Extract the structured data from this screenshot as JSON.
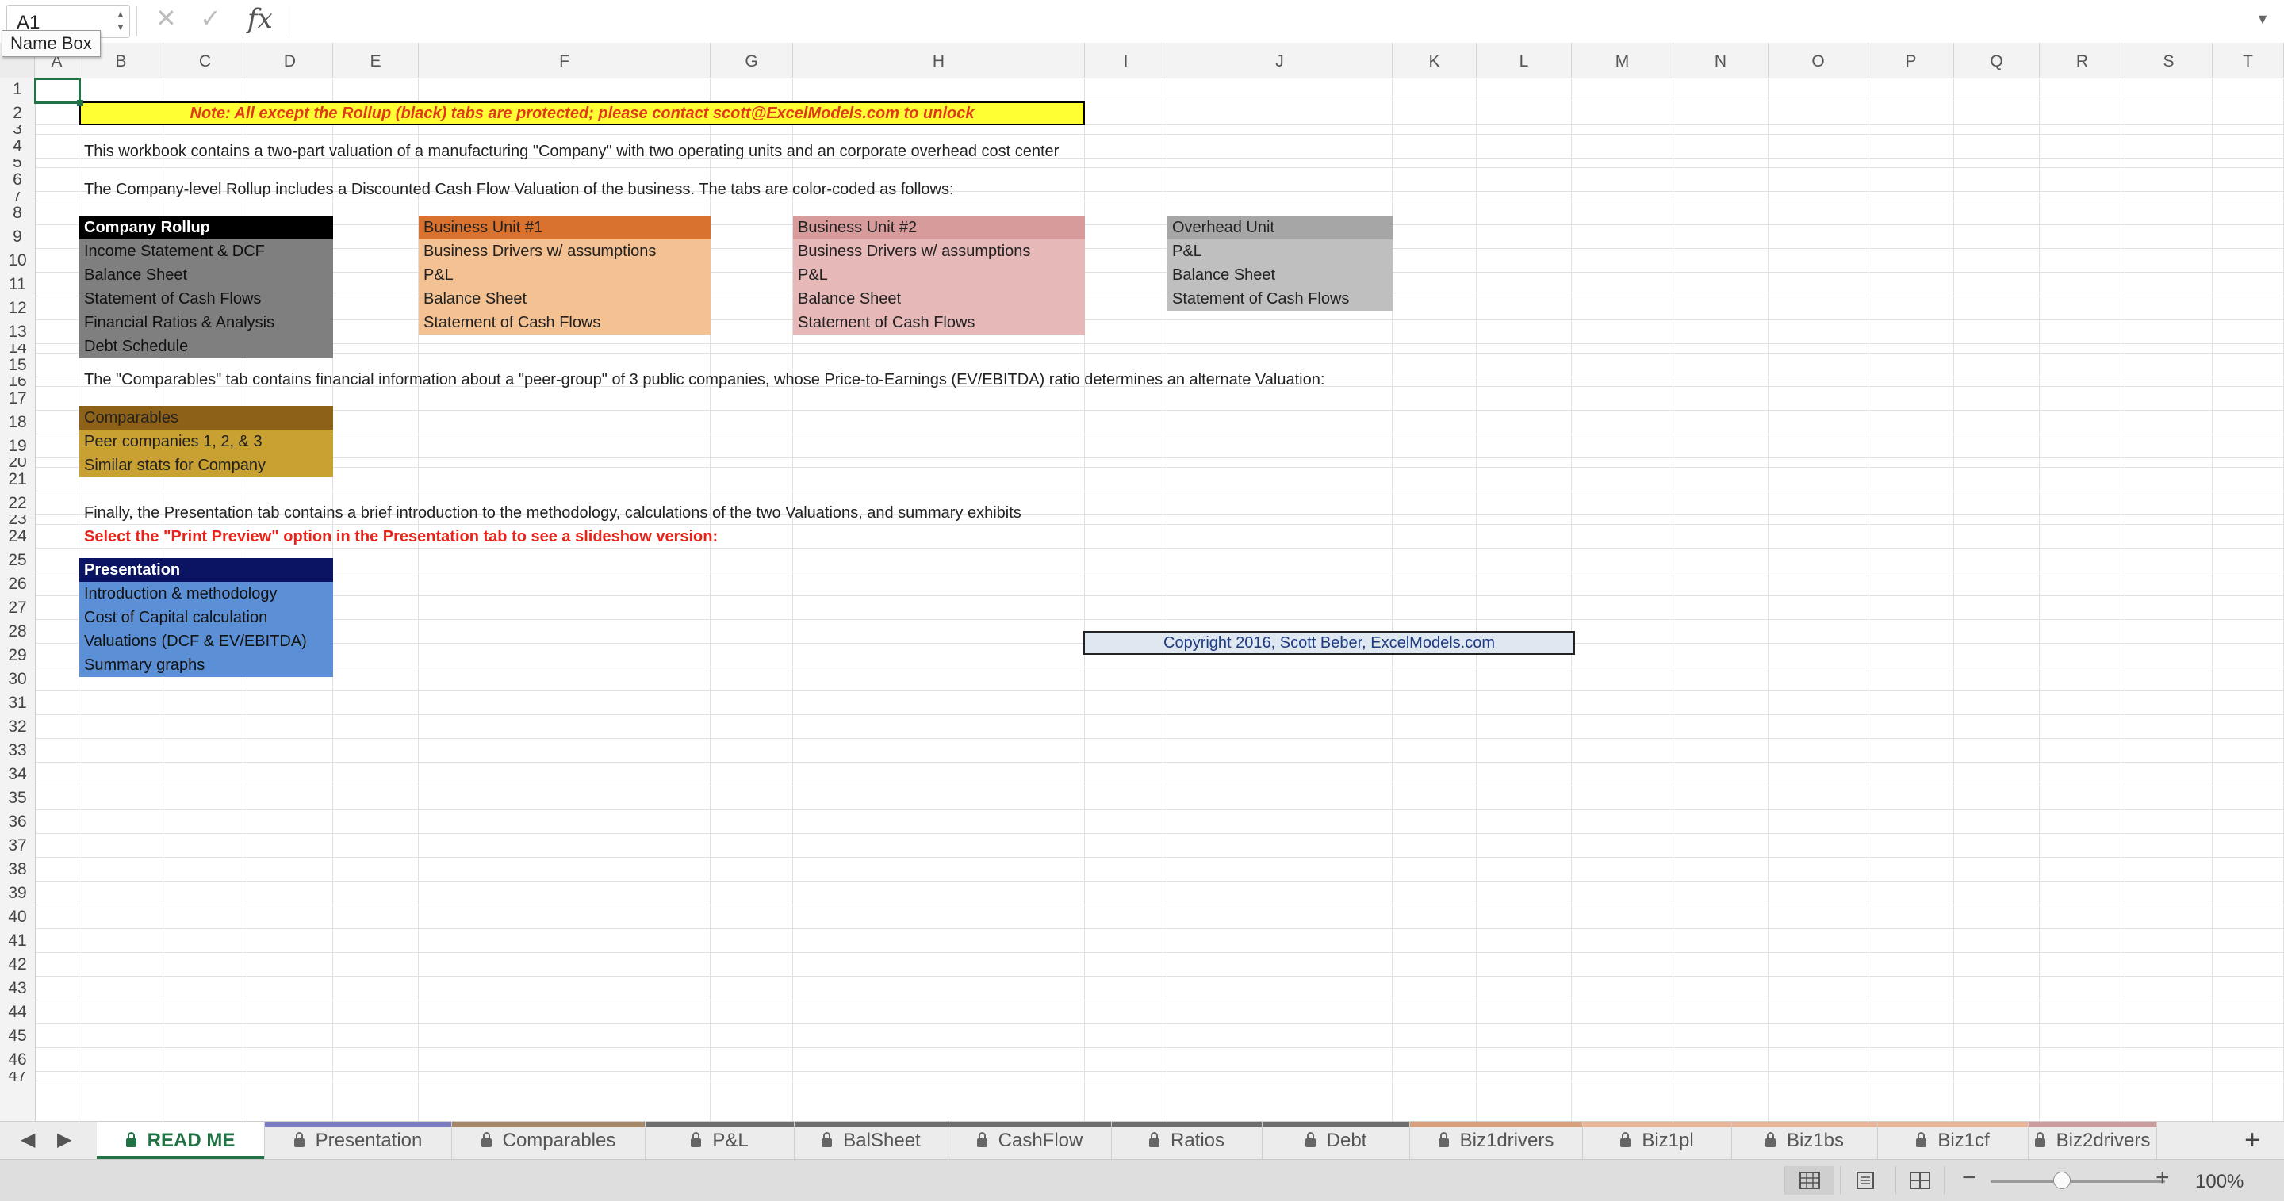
{
  "formula_bar": {
    "name_box": "A1",
    "name_box_tooltip": "Name Box",
    "formula_value": "",
    "icons": [
      "cancel-icon",
      "confirm-icon",
      "function-icon",
      "expand-icon"
    ]
  },
  "columns": [
    "A",
    "B",
    "C",
    "D",
    "E",
    "F",
    "G",
    "H",
    "I",
    "J",
    "K",
    "L",
    "M",
    "N",
    "O",
    "P",
    "Q",
    "R",
    "S",
    "T"
  ],
  "rows": [
    "1",
    "2",
    "3",
    "4",
    "5",
    "6",
    "7",
    "8",
    "9",
    "10",
    "11",
    "12",
    "13",
    "14",
    "15",
    "16",
    "17",
    "18",
    "19",
    "20",
    "21",
    "22",
    "23",
    "24",
    "25",
    "26",
    "27",
    "28",
    "29",
    "30",
    "31",
    "32",
    "33",
    "34",
    "35",
    "36",
    "37",
    "38",
    "39",
    "40",
    "41",
    "42",
    "43",
    "44",
    "45",
    "46",
    "47"
  ],
  "sheet": {
    "note": "Note: All except the Rollup (black) tabs are protected; please contact scott@ExcelModels.com to unlock",
    "intro": "This workbook contains a two-part valuation of a manufacturing \"Company\" with two operating units and an corporate overhead cost center",
    "rollup_text": "The Company-level Rollup includes a Discounted Cash Flow Valuation of the business. The tabs are color-coded as follows:",
    "company_rollup": {
      "header": "Company Rollup",
      "items": [
        "Income Statement & DCF",
        "Balance Sheet",
        "Statement of Cash Flows",
        "Financial Ratios & Analysis",
        "Debt Schedule"
      ]
    },
    "business_unit_1": {
      "header": "Business Unit #1",
      "items": [
        "Business Drivers w/ assumptions",
        "P&L",
        "Balance Sheet",
        "Statement of Cash Flows"
      ]
    },
    "business_unit_2": {
      "header": "Business Unit #2",
      "items": [
        "Business Drivers w/ assumptions",
        "P&L",
        "Balance Sheet",
        "Statement of Cash Flows"
      ]
    },
    "overhead_unit": {
      "header": "Overhead Unit",
      "items": [
        "P&L",
        "Balance Sheet",
        "Statement of Cash Flows"
      ]
    },
    "comparables_text": "The \"Comparables\" tab contains financial information about a \"peer-group\" of 3 public companies, whose  Price-to-Earnings (EV/EBITDA) ratio determines an alternate Valuation:",
    "comparables": {
      "header": "Comparables",
      "items": [
        "Peer companies 1, 2, & 3",
        "Similar stats for Company"
      ]
    },
    "presentation_text": "Finally, the Presentation tab contains a brief introduction to the methodology, calculations of the two Valuations, and summary exhibits",
    "print_preview_text": "Select the \"Print Preview\" option in the Presentation tab to see a slideshow version:",
    "presentation": {
      "header": "Presentation",
      "items": [
        "Introduction & methodology",
        "Cost of Capital calculation",
        "Valuations (DCF & EV/EBITDA)",
        "Summary graphs"
      ]
    },
    "copyright": "Copyright 2016,  Scott Beber, ExcelModels.com"
  },
  "tabs": [
    {
      "label": "READ ME",
      "color": "#ffffff",
      "active": true
    },
    {
      "label": "Presentation",
      "color": "#7b7bc0",
      "active": false
    },
    {
      "label": "Comparables",
      "color": "#a58766",
      "active": false
    },
    {
      "label": "P&L",
      "color": "#6e6e6e",
      "active": false
    },
    {
      "label": "BalSheet",
      "color": "#6e6e6e",
      "active": false
    },
    {
      "label": "CashFlow",
      "color": "#6e6e6e",
      "active": false
    },
    {
      "label": "Ratios",
      "color": "#6e6e6e",
      "active": false
    },
    {
      "label": "Debt",
      "color": "#6e6e6e",
      "active": false
    },
    {
      "label": "Biz1drivers",
      "color": "#d9a07c",
      "active": false
    },
    {
      "label": "Biz1pl",
      "color": "#eab596",
      "active": false
    },
    {
      "label": "Biz1bs",
      "color": "#eab596",
      "active": false
    },
    {
      "label": "Biz1cf",
      "color": "#eab596",
      "active": false
    },
    {
      "label": "Biz2drivers",
      "color": "#cc9c9c",
      "active": false
    }
  ],
  "status_bar": {
    "zoom": "100%",
    "zoom_fraction": 0.41,
    "views": [
      "normal-view-icon",
      "page-layout-icon",
      "page-break-icon"
    ]
  },
  "colors": {
    "accent": "#217346",
    "note_bg": "#ffff33",
    "note_text": "#e03a1a",
    "rollup_header": "#000000",
    "rollup_body": "#7f7f7f",
    "bu1_header": "#d9722e",
    "bu1_body": "#f4c193",
    "bu2_header": "#d79b9b",
    "bu2_body": "#e6b8b7",
    "overhead_header": "#a6a6a6",
    "overhead_body": "#bfbfbf",
    "comparables_header": "#8e6118",
    "comparables_body": "#c9a032",
    "presentation_header": "#0b1363",
    "presentation_body": "#5b8fd6",
    "print_preview_text": "#e8231b",
    "copyright_bg": "#dfe8f1",
    "copyright_text": "#1f3b82"
  }
}
